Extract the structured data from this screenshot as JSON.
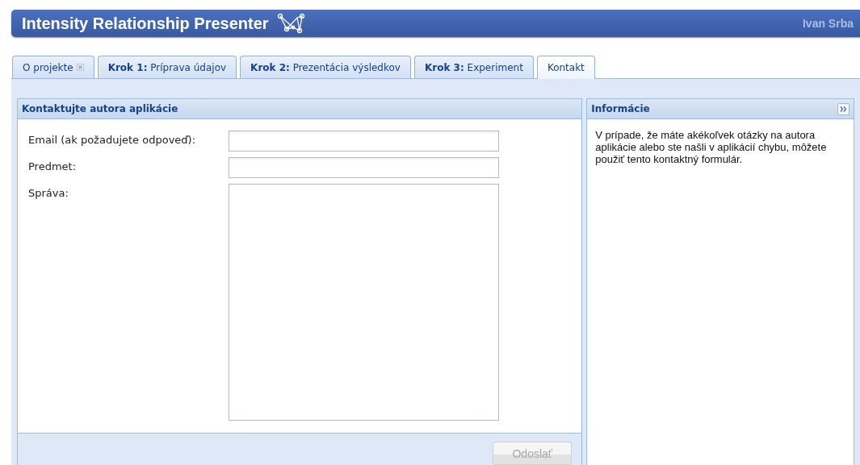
{
  "header": {
    "title": "Intensity Relationship Presenter",
    "user": "Ivan Srba"
  },
  "tabs": [
    {
      "label": "O projekte",
      "selected": false,
      "closable": true
    },
    {
      "label": "**Krok 1:** Príprava údajov",
      "selected": false,
      "closable": false
    },
    {
      "label": "**Krok 2:** Prezentácia výsledkov",
      "selected": false,
      "closable": false
    },
    {
      "label": "**Krok 3:** Experiment",
      "selected": false,
      "closable": false
    },
    {
      "label": "Kontakt",
      "selected": true,
      "closable": false
    }
  ],
  "form_panel": {
    "title": "Kontaktujte autora aplikácie",
    "fields": [
      {
        "label": "Email (ak požadujete odpoveď):",
        "kind": "input"
      },
      {
        "label": "Predmet:",
        "kind": "input"
      },
      {
        "label": "Správa:",
        "kind": "textarea"
      }
    ],
    "submit": {
      "label": "Odoslať",
      "disabled": true
    }
  },
  "info_panel": {
    "title": "Informácie",
    "text": "V prípade, že máte akékoľvek otázky na autora aplikácie alebo ste našli v aplikácií chybu, môžete použiť tento kontaktný formulár."
  }
}
